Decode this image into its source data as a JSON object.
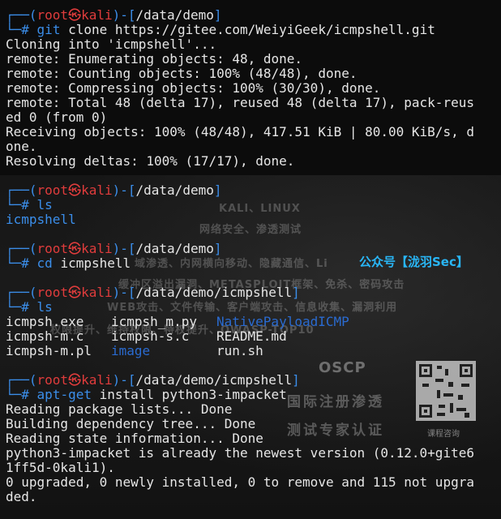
{
  "colors": {
    "prompt_frame": "#3b8eea",
    "prompt_user": "#e03c3c",
    "command": "#3b8eea",
    "output": "#e6e6e6",
    "background": "#0c0c0c",
    "watermark_account": "#29b6f6"
  },
  "prompt": {
    "user": "root",
    "symbol": "㉿",
    "host": "kali",
    "hash": "#"
  },
  "blocks": [
    {
      "dir": "/data/demo",
      "cmd": "git",
      "args": " clone https://gitee.com/WeiyiGeek/icmpshell.git",
      "output": [
        "Cloning into 'icmpshell'...",
        "remote: Enumerating objects: 48, done.",
        "remote: Counting objects: 100% (48/48), done.",
        "remote: Compressing objects: 100% (30/30), done.",
        "remote: Total 48 (delta 17), reused 48 (delta 17), pack-reus",
        "ed 0 (from 0)",
        "Receiving objects: 100% (48/48), 417.51 KiB | 80.00 KiB/s, d",
        "one.",
        "Resolving deltas: 100% (17/17), done."
      ]
    },
    {
      "dir": "/data/demo",
      "cmd": "ls",
      "args": "",
      "listing": "icmpshell"
    },
    {
      "dir": "/data/demo",
      "cmd": "cd",
      "args": " icmpshell"
    },
    {
      "dir": "/data/demo/icmpshell",
      "cmd": "ls",
      "args": "",
      "files": [
        [
          "icmpsh.exe",
          "icmpsh_m.py",
          "NativePayloadICMP"
        ],
        [
          "icmpsh-m.c",
          "icmpsh-s.c",
          "README.md"
        ],
        [
          "icmpsh-m.pl",
          "image",
          "run.sh"
        ]
      ]
    },
    {
      "dir": "/data/demo/icmpshell",
      "cmd": "apt-get",
      "args": " install python3-impacket",
      "output": [
        "Reading package lists... Done",
        "Building dependency tree... Done",
        "Reading state information... Done",
        "python3-impacket is already the newest version (0.12.0+gite6",
        "1ff5d-0kali1).",
        "0 upgraded, 0 newly installed, 0 to remove and 115 not upgra",
        "ded."
      ]
    }
  ],
  "watermark": {
    "line1": "KALI、LINUX",
    "line2": "网络安全、渗透测试",
    "line3": "域渗透、内网横向移动、隐藏通信、Li",
    "line4": "缓冲区溢出漏洞、METASPLOIT框架、免杀、密码攻击",
    "line5": "WEB攻击、文件传输、客户端攻击、信息收集、漏洞利用",
    "line6": "权限提升、维持权限、特权提升、OWASP-TOP10",
    "account": "公众号【泷羽Sec】",
    "oscp": "OSCP",
    "cert1": "国际注册渗透",
    "cert2": "测试专家认证",
    "qr_caption": "课程咨询"
  }
}
